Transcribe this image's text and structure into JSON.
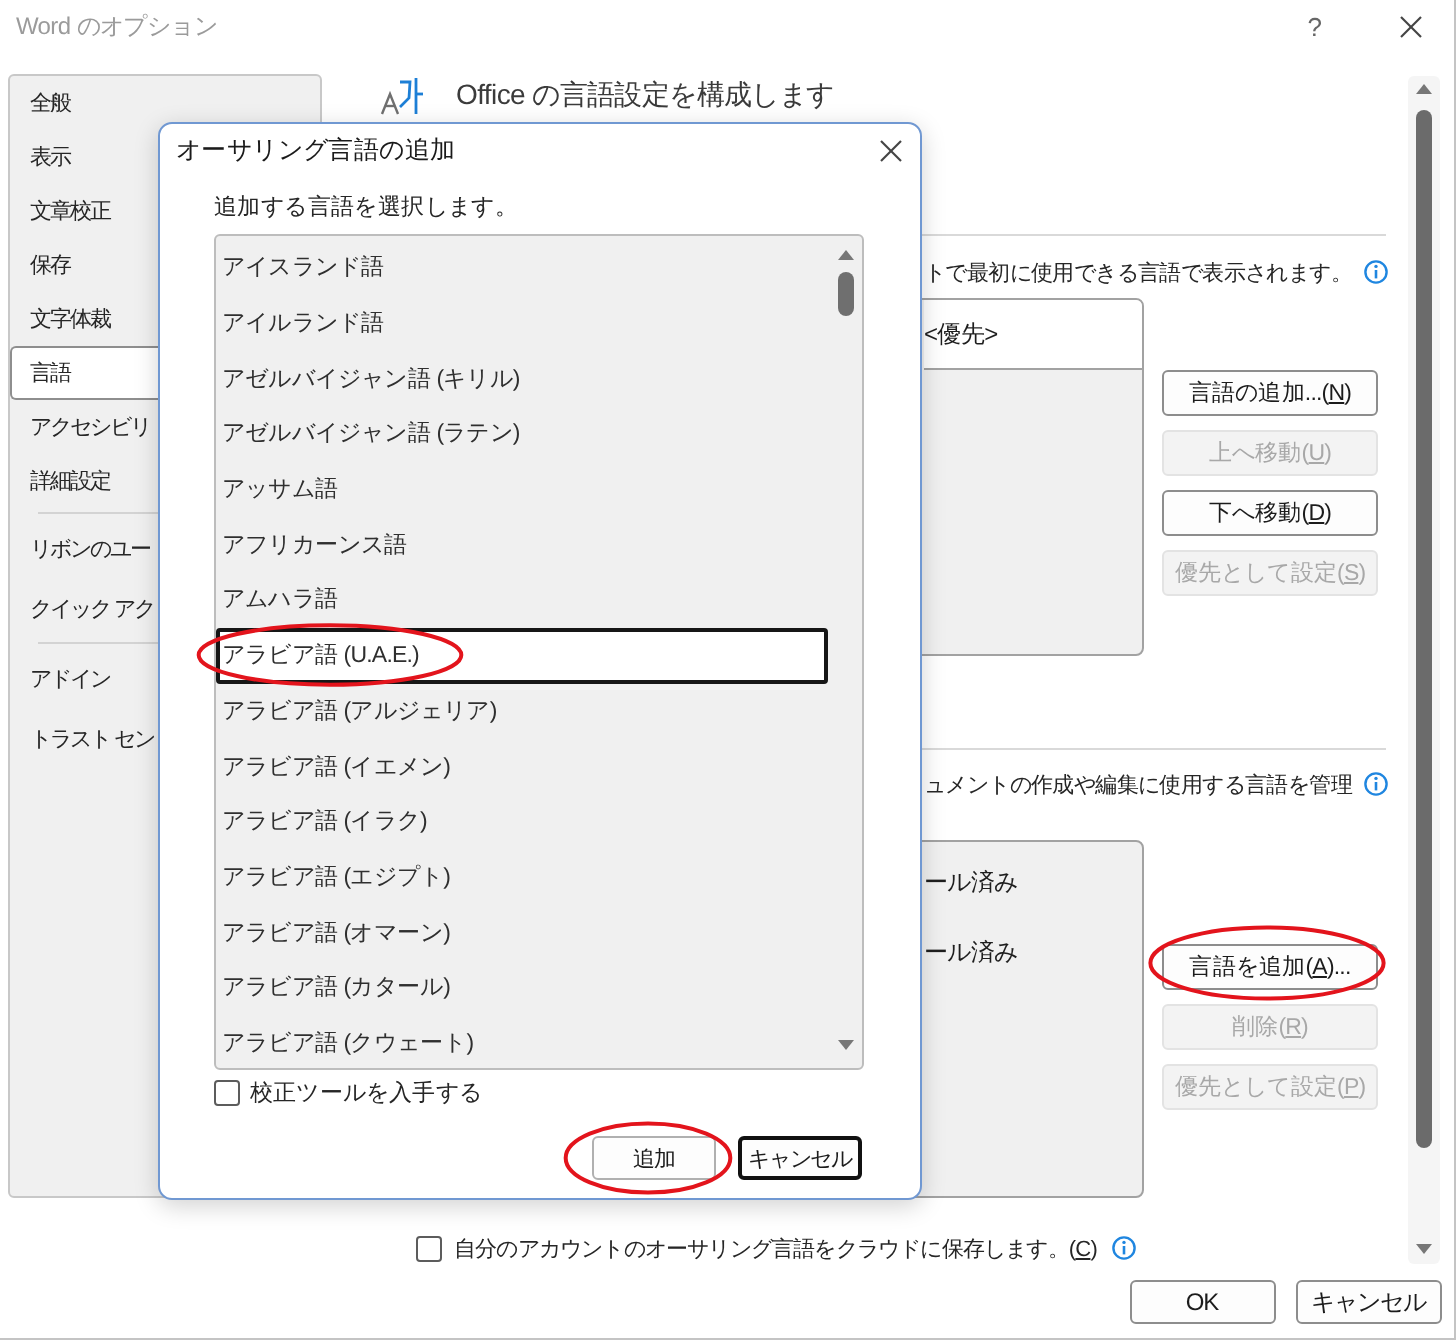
{
  "window": {
    "title": "Word のオプション",
    "help": "?"
  },
  "sidebar": {
    "groups": [
      [
        {
          "label": "全般",
          "selected": false
        },
        {
          "label": "表示",
          "selected": false
        },
        {
          "label": "文章校正",
          "selected": false
        },
        {
          "label": "保存",
          "selected": false
        },
        {
          "label": "文字体裁",
          "selected": false
        },
        {
          "label": "言語",
          "selected": true
        },
        {
          "label": "アクセシビリ",
          "selected": false
        },
        {
          "label": "詳細設定",
          "selected": false
        }
      ],
      [
        {
          "label": "リボンのユー",
          "selected": false
        },
        {
          "label": "クイック アク",
          "selected": false
        }
      ],
      [
        {
          "label": "アドイン",
          "selected": false
        },
        {
          "label": "トラスト セン",
          "selected": false
        }
      ]
    ]
  },
  "content": {
    "heading": "Office の言語設定を構成します",
    "sections": [
      {
        "description": "トで最初に使用できる言語で表示されます。",
        "rows": [
          {
            "text": "<優先>",
            "selected": true
          }
        ],
        "buttons": [
          {
            "text": "言語の追加...(",
            "accel": "N",
            "suffix": ")",
            "disabled": false,
            "circled": false
          },
          {
            "text": "上へ移動(",
            "accel": "U",
            "suffix": ")",
            "disabled": true,
            "circled": false
          },
          {
            "text": "下へ移動(",
            "accel": "D",
            "suffix": ")",
            "disabled": false,
            "circled": false
          },
          {
            "text": "優先として設定(",
            "accel": "S",
            "suffix": ")",
            "disabled": true,
            "circled": false
          }
        ]
      },
      {
        "description": "ュメントの作成や編集に使用する言語を管理",
        "rows": [
          {
            "text": "ール済み",
            "selected": false
          },
          {
            "text": "ール済み",
            "selected": false
          }
        ],
        "buttons": [
          {
            "text": "言語を追加(",
            "accel": "A",
            "suffix": ")...",
            "disabled": false,
            "circled": true
          },
          {
            "text": "削除(",
            "accel": "R",
            "suffix": ")",
            "disabled": true,
            "circled": false
          },
          {
            "text": "優先として設定(",
            "accel": "P",
            "suffix": ")",
            "disabled": true,
            "circled": false
          }
        ]
      }
    ],
    "cloud_option": {
      "text": "自分のアカウントのオーサリング言語をクラウドに保存します。(",
      "accel": "C",
      "suffix": ")",
      "checked": false
    }
  },
  "footer": {
    "buttons": [
      {
        "label": "OK"
      },
      {
        "label": "キャンセル"
      }
    ]
  },
  "dialog": {
    "title": "オーサリング言語の追加",
    "prompt": "追加する言語を選択します。",
    "languages": [
      {
        "name": "アイスランド語",
        "selected": false,
        "circled": false
      },
      {
        "name": "アイルランド語",
        "selected": false,
        "circled": false
      },
      {
        "name": "アゼルバイジャン語 (キリル)",
        "selected": false,
        "circled": false
      },
      {
        "name": "アゼルバイジャン語 (ラテン)",
        "selected": false,
        "circled": false
      },
      {
        "name": "アッサム語",
        "selected": false,
        "circled": false
      },
      {
        "name": "アフリカーンス語",
        "selected": false,
        "circled": false
      },
      {
        "name": "アムハラ語",
        "selected": false,
        "circled": false
      },
      {
        "name": "アラビア語 (U.A.E.)",
        "selected": true,
        "circled": true
      },
      {
        "name": "アラビア語 (アルジェリア)",
        "selected": false,
        "circled": false
      },
      {
        "name": "アラビア語 (イエメン)",
        "selected": false,
        "circled": false
      },
      {
        "name": "アラビア語 (イラク)",
        "selected": false,
        "circled": false
      },
      {
        "name": "アラビア語 (エジプト)",
        "selected": false,
        "circled": false
      },
      {
        "name": "アラビア語 (オマーン)",
        "selected": false,
        "circled": false
      },
      {
        "name": "アラビア語 (カタール)",
        "selected": false,
        "circled": false
      },
      {
        "name": "アラビア語 (クウェート)",
        "selected": false,
        "circled": false
      }
    ],
    "proofing_option": {
      "label": "校正ツールを入手する",
      "checked": false
    },
    "buttons": [
      {
        "label": "追加",
        "focused": false,
        "circled": true
      },
      {
        "label": "キャンセル",
        "focused": true,
        "circled": false
      }
    ]
  }
}
